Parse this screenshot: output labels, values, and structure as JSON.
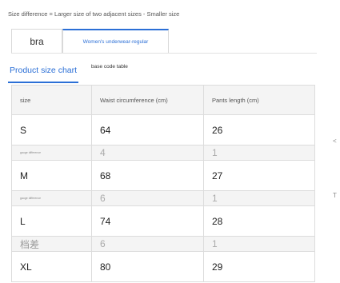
{
  "note": "Size difference = Larger size of two adjacent sizes - Smaller size",
  "tabs": [
    {
      "label": "bra",
      "active": false
    },
    {
      "label": "Women's underwear-regular",
      "active": true
    }
  ],
  "subtabs": {
    "active": "Product size chart",
    "other": "base code table"
  },
  "table": {
    "headers": [
      "size",
      "Waist circumference (cm)",
      "Pants length (cm)"
    ],
    "rows": [
      {
        "type": "size",
        "cells": [
          "S",
          "64",
          "26"
        ]
      },
      {
        "type": "diff",
        "cells": [
          "gauge difference",
          "4",
          "1"
        ]
      },
      {
        "type": "size",
        "cells": [
          "M",
          "68",
          "27"
        ]
      },
      {
        "type": "diff",
        "cells": [
          "gauge difference",
          "6",
          "1"
        ]
      },
      {
        "type": "size",
        "cells": [
          "L",
          "74",
          "28"
        ]
      },
      {
        "type": "diff",
        "cells": [
          "档差",
          "6",
          "1"
        ]
      },
      {
        "type": "size",
        "cells": [
          "XL",
          "80",
          "29"
        ]
      }
    ]
  },
  "edge_marks": [
    "<",
    "T"
  ],
  "colors": {
    "accent": "#2b6fd6",
    "header_bg": "#f4f4f4",
    "border": "#dcdcdc"
  }
}
